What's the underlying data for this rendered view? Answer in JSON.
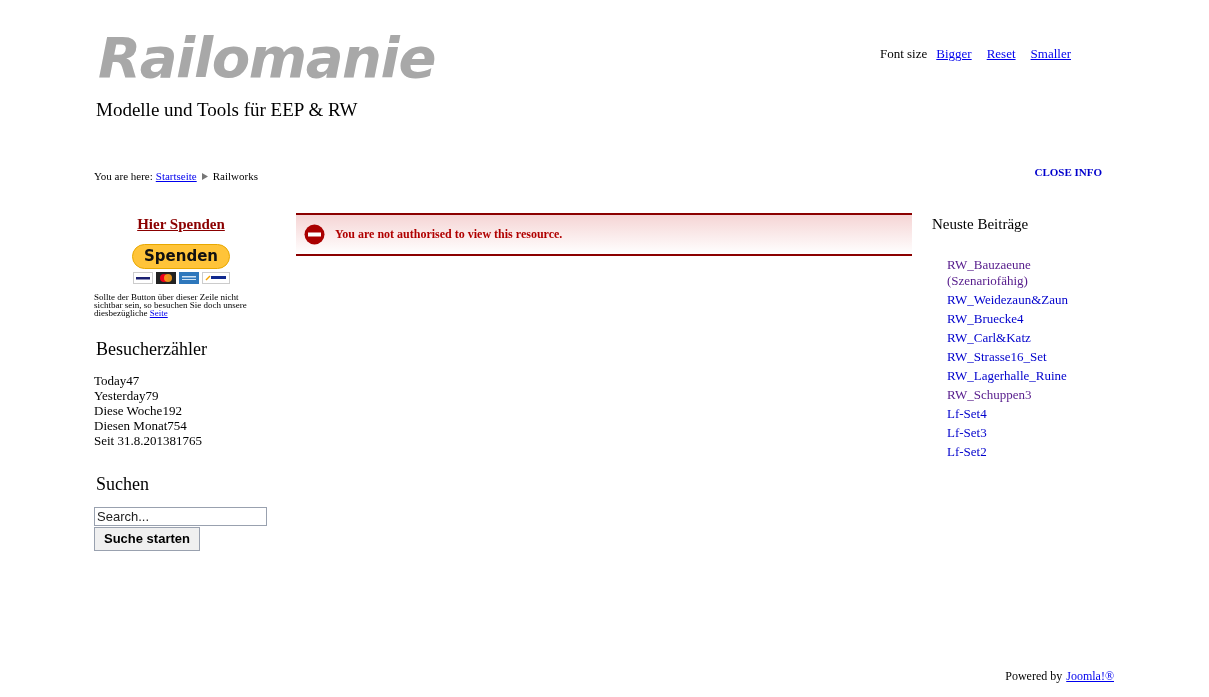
{
  "header": {
    "logo": "Railomanie",
    "tagline": "Modelle und Tools für EEP & RW",
    "font_size": {
      "label": "Font size",
      "links": [
        "Bigger",
        "Reset",
        "Smaller"
      ]
    }
  },
  "breadcrumb": {
    "label": "You are here:",
    "items": [
      {
        "text": "Startseite",
        "link": true
      },
      {
        "text": "Railworks",
        "link": false
      }
    ]
  },
  "close_info": "CLOSE INFO",
  "donate": {
    "title": "Hier Spenden",
    "button": "Spenden",
    "cards": [
      {
        "kind": "visa"
      },
      {
        "kind": "mastercard"
      },
      {
        "kind": "amex"
      },
      {
        "kind": "sepa"
      }
    ],
    "note": "Sollte der Button über dieser Zeile nicht sichtbar sein, so besuchen Sie doch unsere diesbezügliche",
    "note_link": "Seite"
  },
  "counter": {
    "title": "Besucherzähler",
    "lines": [
      "Today47",
      "Yesterday79",
      "Diese Woche192",
      "Diesen Monat754",
      "Seit 31.8.201381765"
    ]
  },
  "search": {
    "title": "Suchen",
    "placeholder": "Search...",
    "button": "Suche starten"
  },
  "message": "You are not authorised to view this resource.",
  "latest": {
    "title": "Neuste Beiträge",
    "items": [
      {
        "text": "RW_Bauzaeune (Szenariofähig)",
        "visited": true
      },
      {
        "text": "RW_Weidezaun&Zaun",
        "visited": false
      },
      {
        "text": "RW_Bruecke4",
        "visited": false
      },
      {
        "text": "RW_Carl&Katz",
        "visited": false
      },
      {
        "text": "RW_Strasse16_Set",
        "visited": false
      },
      {
        "text": "RW_Lagerhalle_Ruine",
        "visited": false
      },
      {
        "text": "RW_Schuppen3",
        "visited": true
      },
      {
        "text": "Lf-Set4",
        "visited": false
      },
      {
        "text": "Lf-Set3",
        "visited": false
      },
      {
        "text": "Lf-Set2",
        "visited": false
      }
    ]
  },
  "footer": {
    "label": "Powered by",
    "link": "Joomla!®"
  }
}
